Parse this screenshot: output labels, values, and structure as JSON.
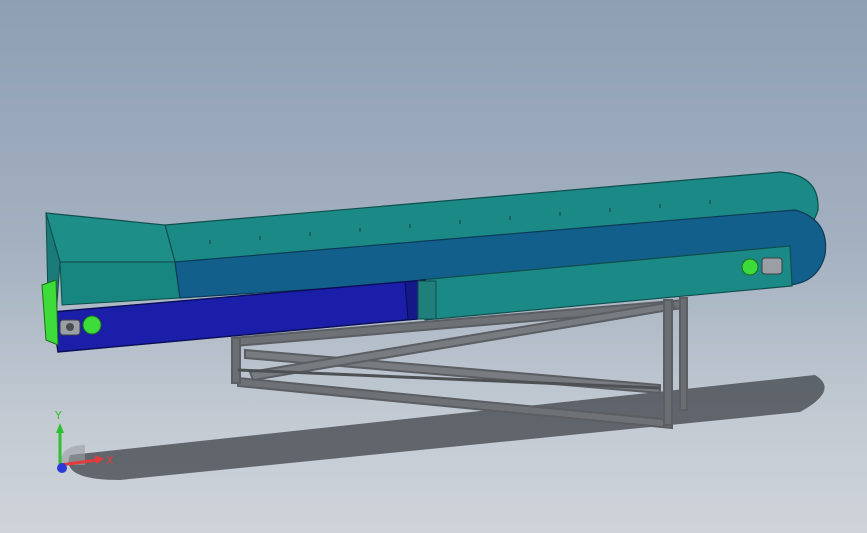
{
  "viewport": {
    "background_top": "#8e9fb4",
    "background_bottom": "#cfd4da"
  },
  "model": {
    "belt_color": "#1b8a86",
    "belt_inner_color": "#135f8c",
    "side_guard_color": "#1a1ea8",
    "roller_highlight_color": "#3ddc3a",
    "frame_color": "#707478"
  },
  "triad": {
    "x_label": "X",
    "y_label": "Y",
    "x_color": "#e23c3c",
    "y_color": "#2fbf2f",
    "z_color": "#2d3bd6"
  }
}
